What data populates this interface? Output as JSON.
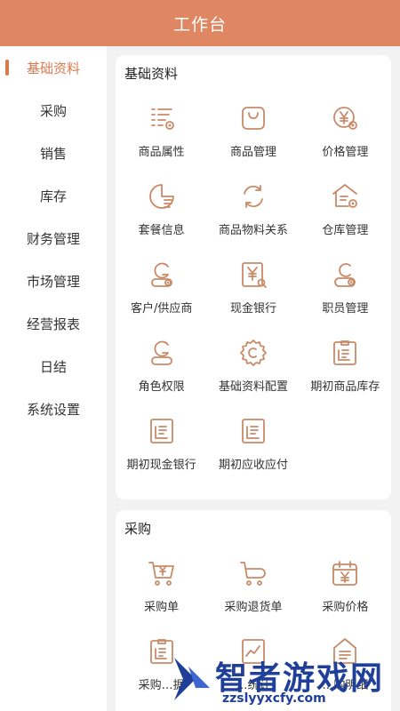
{
  "header": {
    "title": "工作台"
  },
  "sidebar": {
    "items": [
      {
        "label": "基础资料",
        "active": true
      },
      {
        "label": "采购"
      },
      {
        "label": "销售"
      },
      {
        "label": "库存"
      },
      {
        "label": "财务管理"
      },
      {
        "label": "市场管理"
      },
      {
        "label": "经营报表"
      },
      {
        "label": "日结"
      },
      {
        "label": "系统设置"
      }
    ]
  },
  "sections": [
    {
      "title": "基础资料",
      "items": [
        {
          "label": "商品属性",
          "icon": "list-icon"
        },
        {
          "label": "商品管理",
          "icon": "bag-icon"
        },
        {
          "label": "价格管理",
          "icon": "yen-coin-icon"
        },
        {
          "label": "套餐信息",
          "icon": "package-icon"
        },
        {
          "label": "商品物料关系",
          "icon": "refresh-icon"
        },
        {
          "label": "仓库管理",
          "icon": "warehouse-icon"
        },
        {
          "label": "客户/供应商",
          "icon": "customer-icon"
        },
        {
          "label": "现金银行",
          "icon": "cash-bank-icon"
        },
        {
          "label": "职员管理",
          "icon": "staff-icon"
        },
        {
          "label": "角色权限",
          "icon": "role-icon"
        },
        {
          "label": "基础资料配置",
          "icon": "settings-gear-icon"
        },
        {
          "label": "期初商品库存",
          "icon": "clipboard-icon"
        },
        {
          "label": "期初现金银行",
          "icon": "document-icon"
        },
        {
          "label": "期初应收应付",
          "icon": "document-icon"
        }
      ]
    },
    {
      "title": "采购",
      "items": [
        {
          "label": "采购单",
          "icon": "cart-yen-icon"
        },
        {
          "label": "采购退货单",
          "icon": "cart-return-icon"
        },
        {
          "label": "采购价格",
          "icon": "calendar-yen-icon"
        },
        {
          "label": "采购…据",
          "icon": "clipboard-icon"
        },
        {
          "label": "…统计",
          "icon": "chart-icon"
        },
        {
          "label": "…购明细",
          "icon": "detail-icon"
        }
      ]
    }
  ],
  "watermark": {
    "title": "智者游戏网",
    "url": "zzslyyxcfy.com"
  },
  "colors": {
    "header": "#de8762",
    "accent": "#d9794f",
    "icon": "#c98a68"
  }
}
